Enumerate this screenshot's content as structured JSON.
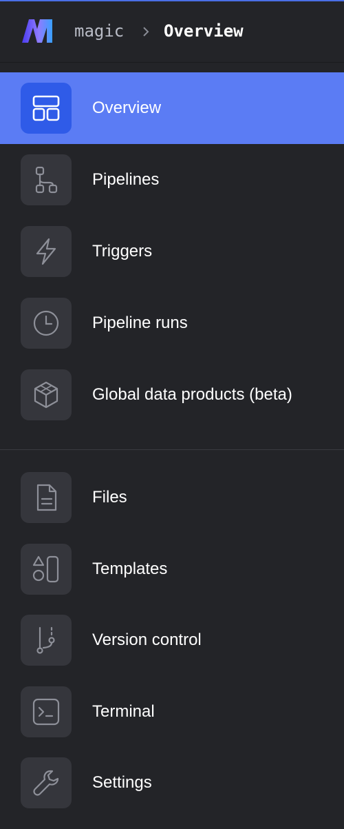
{
  "header": {
    "root": "magic",
    "current": "Overview",
    "brand_colors": [
      "#4b3cf0",
      "#8f7bff",
      "#3aa0ff"
    ]
  },
  "nav": {
    "group1": [
      {
        "label": "Overview",
        "icon": "overview-icon",
        "active": true
      },
      {
        "label": "Pipelines",
        "icon": "pipelines-icon",
        "active": false
      },
      {
        "label": "Triggers",
        "icon": "lightning-icon",
        "active": false
      },
      {
        "label": "Pipeline runs",
        "icon": "clock-icon",
        "active": false
      },
      {
        "label": "Global data products (beta)",
        "icon": "cube-icon",
        "active": false
      }
    ],
    "group2": [
      {
        "label": "Files",
        "icon": "file-icon",
        "active": false
      },
      {
        "label": "Templates",
        "icon": "templates-icon",
        "active": false
      },
      {
        "label": "Version control",
        "icon": "branch-icon",
        "active": false
      },
      {
        "label": "Terminal",
        "icon": "terminal-icon",
        "active": false
      },
      {
        "label": "Settings",
        "icon": "wrench-icon",
        "active": false
      }
    ]
  },
  "colors": {
    "active_background": "#5b7cf4",
    "active_icon_box": "#2f5be8",
    "icon_box": "#35363c",
    "sidebar_background": "#232428"
  }
}
